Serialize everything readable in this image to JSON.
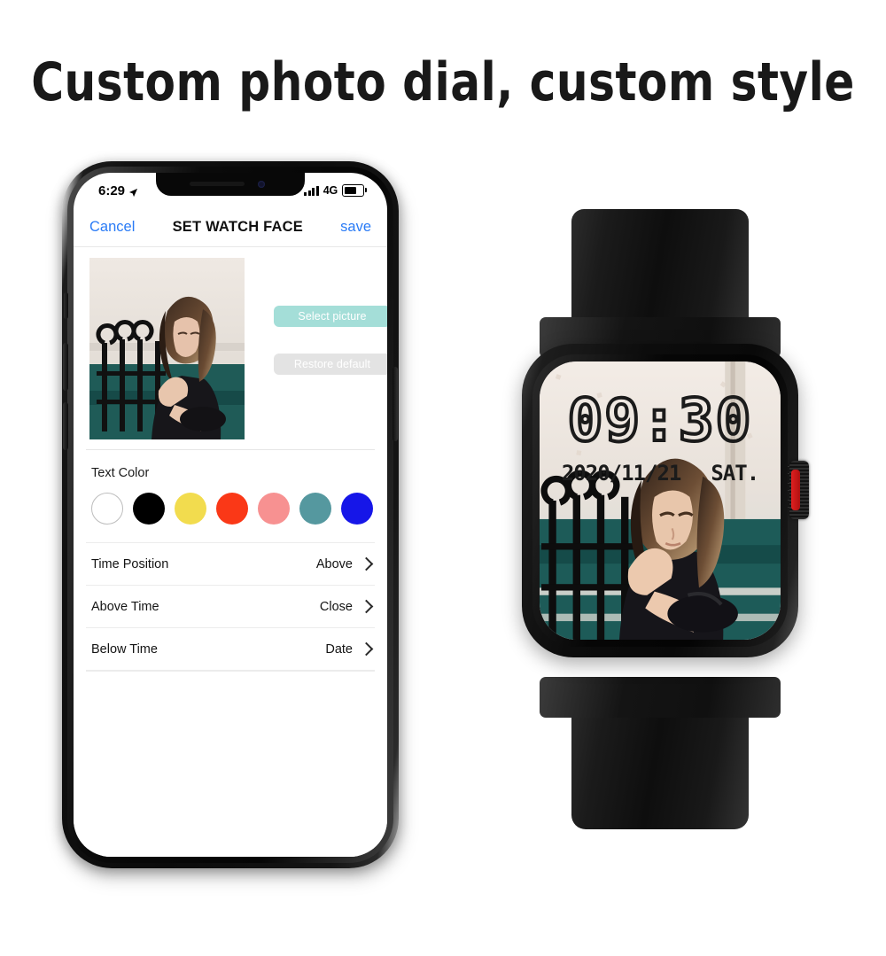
{
  "headline": "Custom photo dial, custom style",
  "phone": {
    "status_bar": {
      "time": "6:29",
      "location_icon": "location-arrow-icon",
      "signal_icon": "signal-bars-icon",
      "network": "4G",
      "battery_icon": "battery-icon",
      "battery_level_percent": 60
    },
    "nav_bar": {
      "cancel_label": "Cancel",
      "title": "SET WATCH FACE",
      "save_label": "save"
    },
    "preview": {
      "image_alt": "woman standing by iron fence with teal car"
    },
    "buttons": {
      "select_picture": "Select picture",
      "restore_default": "Restore default"
    },
    "text_color": {
      "label": "Text Color",
      "swatches": [
        {
          "name": "white",
          "hex": "#ffffff",
          "selected": true
        },
        {
          "name": "black",
          "hex": "#000000",
          "selected": false
        },
        {
          "name": "yellow",
          "hex": "#f2dc4e",
          "selected": false
        },
        {
          "name": "red",
          "hex": "#fa3817",
          "selected": false
        },
        {
          "name": "pink",
          "hex": "#f79191",
          "selected": false
        },
        {
          "name": "teal",
          "hex": "#55989f",
          "selected": false
        },
        {
          "name": "blue",
          "hex": "#1616e8",
          "selected": false
        }
      ]
    },
    "settings_rows": [
      {
        "label": "Time Position",
        "value": "Above"
      },
      {
        "label": "Above Time",
        "value": "Close"
      },
      {
        "label": "Below Time",
        "value": "Date"
      }
    ]
  },
  "watch": {
    "face": {
      "time": "09:30",
      "date": "2020/11/21",
      "weekday": "SAT.",
      "time_color": "#1b1b1b"
    },
    "crown_accent_color": "#e02020",
    "body_color": "#0c0c0c"
  },
  "accent": {
    "ios_blue": "#2a7bf6",
    "select_button_bg": "#a4ded8",
    "restore_button_bg": "#e3e3e3"
  }
}
